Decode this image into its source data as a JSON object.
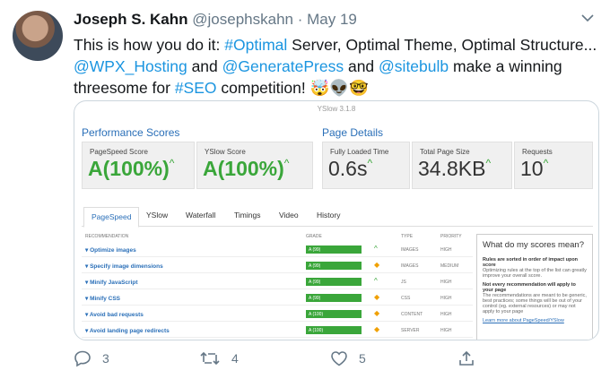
{
  "author": {
    "name": "Joseph S. Kahn",
    "handle": "@josephskahn",
    "separator": "·",
    "date": "May 19"
  },
  "tweet": {
    "seg1": "This is how you do it: ",
    "tag1": "#Optimal",
    "seg2": " Server, Optimal Theme, Optimal Structure...",
    "mention1": "@WPX_Hosting",
    "seg3": " and ",
    "mention2": "@GeneratePress",
    "seg4": " and ",
    "mention3": "@sitebulb",
    "seg5": " make a winning threesome for ",
    "tag2": "#SEO",
    "seg6": " competition! 🤯👽🤓"
  },
  "media": {
    "tool_title": "YSlow 3.1.8",
    "perf_title": "Performance Scores",
    "page_title": "Page Details",
    "scores": [
      {
        "label": "PageSpeed Score",
        "grade": "A",
        "value": "(100%)",
        "trend": "^"
      },
      {
        "label": "YSlow Score",
        "grade": "A",
        "value": "(100%)",
        "trend": "^"
      }
    ],
    "details": [
      {
        "label": "Fully Loaded Time",
        "value": "0.6s",
        "trend": "^"
      },
      {
        "label": "Total Page Size",
        "value": "34.8KB",
        "trend": "^"
      },
      {
        "label": "Requests",
        "value": "10",
        "trend": "^"
      }
    ],
    "tabs": [
      "PageSpeed",
      "YSlow",
      "Waterfall",
      "Timings",
      "Video",
      "History"
    ],
    "columns": {
      "rec": "RECOMMENDATION",
      "grade": "GRADE",
      "type": "TYPE",
      "priority": "PRIORITY"
    },
    "rows": [
      {
        "name": "▾ Optimize images",
        "grade": "A (99)",
        "type": "IMAGES",
        "priority": "HIGH",
        "indicator": "^",
        "ind_color": "#3aa63a"
      },
      {
        "name": "▾ Specify image dimensions",
        "grade": "A (99)",
        "type": "IMAGES",
        "priority": "MEDIUM",
        "indicator": "◆",
        "ind_color": "#f0a000"
      },
      {
        "name": "▾ Minify JavaScript",
        "grade": "A (99)",
        "type": "JS",
        "priority": "HIGH",
        "indicator": "^",
        "ind_color": "#3aa63a"
      },
      {
        "name": "▾ Minify CSS",
        "grade": "A (99)",
        "type": "CSS",
        "priority": "HIGH",
        "indicator": "◆",
        "ind_color": "#f0a000"
      },
      {
        "name": "▾ Avoid bad requests",
        "grade": "A (100)",
        "type": "CONTENT",
        "priority": "HIGH",
        "indicator": "◆",
        "ind_color": "#f0a000"
      },
      {
        "name": "▾ Avoid landing page redirects",
        "grade": "A (100)",
        "type": "SERVER",
        "priority": "HIGH",
        "indicator": "◆",
        "ind_color": "#f0a000"
      }
    ],
    "side": {
      "heading": "What do my scores mean?",
      "b1": "Rules are sorted in order of impact upon score",
      "p1": "Optimizing rules at the top of the list can greatly improve your overall score.",
      "b2": "Not every recommendation will apply to your page",
      "p2": "The recommendations are meant to be generic, best practices; some things will be out of your control (eg. external resources) or may not apply to your page",
      "link": "Learn more about PageSpeed/YSlow"
    }
  },
  "actions": {
    "replies": "3",
    "retweets": "4",
    "likes": "5"
  },
  "colors": {
    "link": "#1b95e0",
    "muted": "#657786",
    "grade_green": "#3aa63a",
    "section_blue": "#2a6fb8"
  }
}
